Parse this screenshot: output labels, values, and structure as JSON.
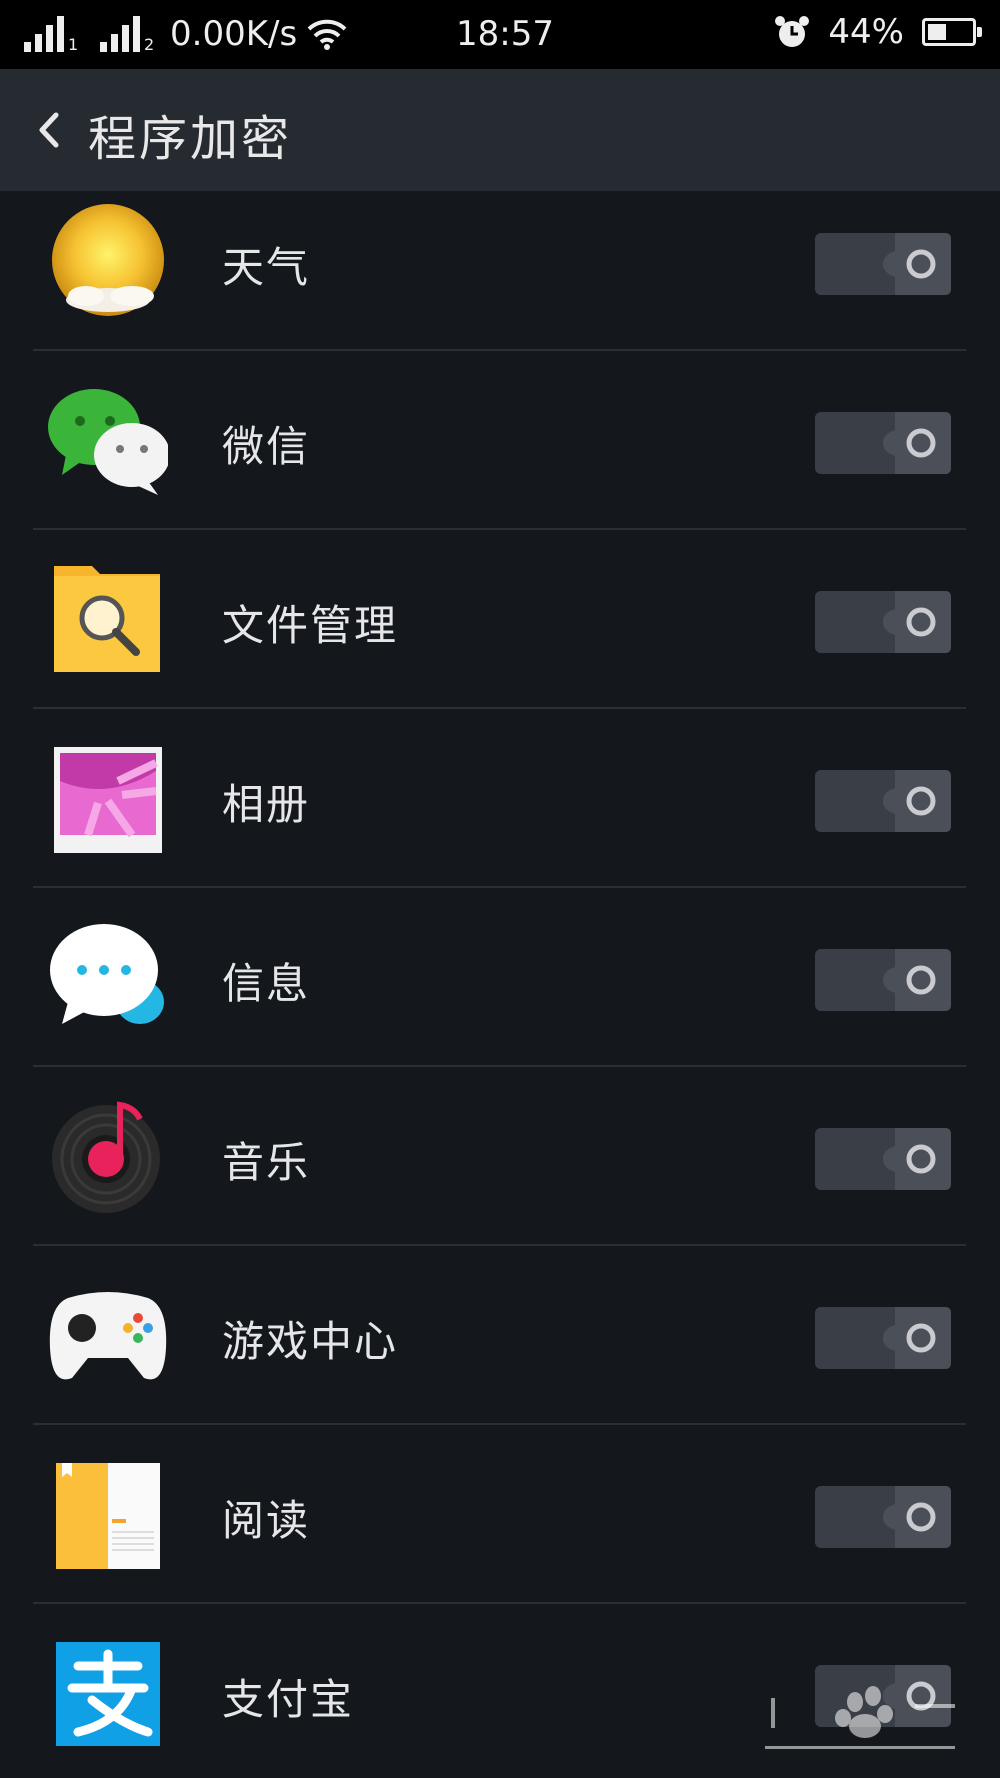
{
  "status_bar": {
    "sim1_label": "1",
    "sim2_label": "2",
    "net_speed": "0.00K/s",
    "time": "18:57",
    "battery_text": "44%",
    "battery_level": 0.44
  },
  "header": {
    "title": "程序加密",
    "back_icon": "chevron-left-icon"
  },
  "apps": [
    {
      "label": "天气",
      "icon": "weather-sun-icon",
      "locked": false
    },
    {
      "label": "微信",
      "icon": "wechat-icon",
      "locked": false
    },
    {
      "label": "文件管理",
      "icon": "file-manager-icon",
      "locked": false
    },
    {
      "label": "相册",
      "icon": "gallery-icon",
      "locked": false
    },
    {
      "label": "信息",
      "icon": "messages-icon",
      "locked": false
    },
    {
      "label": "音乐",
      "icon": "music-icon",
      "locked": false
    },
    {
      "label": "游戏中心",
      "icon": "game-center-icon",
      "locked": false
    },
    {
      "label": "阅读",
      "icon": "reader-icon",
      "locked": false
    },
    {
      "label": "支付宝",
      "icon": "alipay-icon",
      "locked": false
    }
  ],
  "colors": {
    "background": "#14171c",
    "header": "#262a31",
    "toggle_off": "#3a3f47",
    "alipay_blue": "#0fa0e6",
    "wechat_green": "#3ab53a"
  }
}
